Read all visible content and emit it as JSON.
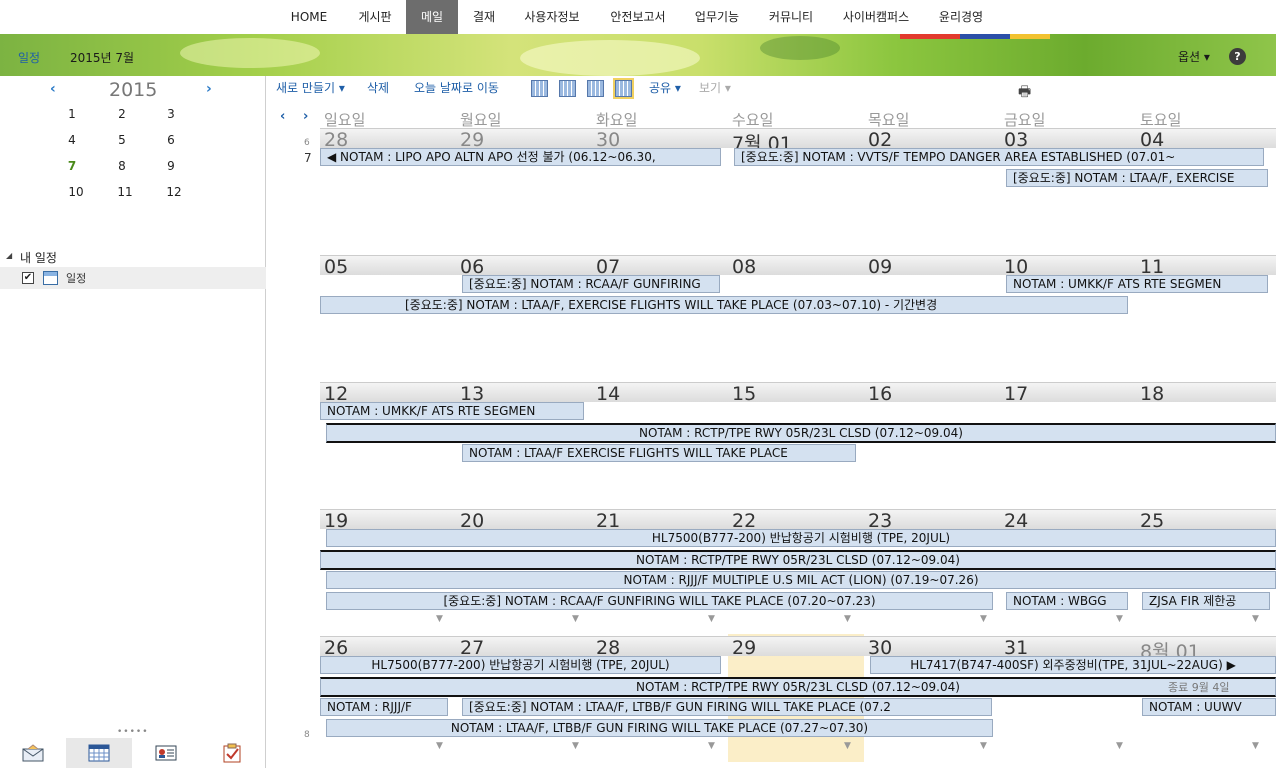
{
  "topnav": {
    "items": [
      "HOME",
      "게시판",
      "메일",
      "결재",
      "사용자정보",
      "안전보고서",
      "업무기능",
      "커뮤니티",
      "사이버캠퍼스",
      "윤리경영"
    ],
    "active": "메일"
  },
  "banner": {
    "section": "일정",
    "period": "2015년 7월",
    "options": "옵션 ▾",
    "help": "?"
  },
  "minical": {
    "year": "2015",
    "prev": "‹",
    "next": "›",
    "months": [
      "1",
      "2",
      "3",
      "4",
      "5",
      "6",
      "7",
      "8",
      "9",
      "10",
      "11",
      "12"
    ],
    "current_month": "7"
  },
  "tree": {
    "toggle": "◢",
    "root": "내 일정",
    "calendar_name": "일정",
    "checked": "✔"
  },
  "leftpane": {
    "dots": "•••••"
  },
  "bottom_tabs": [
    "mail-icon",
    "calendar-icon",
    "contacts-icon",
    "tasks-icon"
  ],
  "toolbar": {
    "new": "새로 만들기 ▾",
    "delete": "삭제",
    "today": "오늘 날짜로 이동",
    "share": "공유 ▾",
    "view": "보기 ▾",
    "print": "🖶"
  },
  "calendar": {
    "nav_prev": "‹",
    "nav_next": "›",
    "weekdays": [
      "일요일",
      "월요일",
      "화요일",
      "수요일",
      "목요일",
      "금요일",
      "토요일"
    ],
    "week_labels": {
      "w1_num": "6",
      "w1_mon": "7",
      "last_num": "8"
    },
    "weeks": [
      {
        "days": [
          "28",
          "29",
          "30",
          "7월 01",
          "02",
          "03",
          "04"
        ]
      },
      {
        "days": [
          "05",
          "06",
          "07",
          "08",
          "09",
          "10",
          "11"
        ]
      },
      {
        "days": [
          "12",
          "13",
          "14",
          "15",
          "16",
          "17",
          "18"
        ]
      },
      {
        "days": [
          "19",
          "20",
          "21",
          "22",
          "23",
          "24",
          "25"
        ]
      },
      {
        "days": [
          "26",
          "27",
          "28",
          "29",
          "30",
          "31",
          "8월 01"
        ]
      }
    ],
    "today_label": "29",
    "end_label": "종료 9월 4일",
    "events": {
      "w1e1": "◀ NOTAM : LIPO APO ALTN APO 선정 불가 (06.12~06.30,",
      "w1e2": "[중요도:중] NOTAM : VVTS/F TEMPO DANGER AREA ESTABLISHED (07.01~",
      "w1e3": "[중요도:중] NOTAM : LTAA/F, EXERCISE",
      "w2e1": "[중요도:중] NOTAM : RCAA/F GUNFIRING",
      "w2e2": "NOTAM : UMKK/F ATS RTE SEGMEN",
      "w2e3": "[중요도:중] NOTAM : LTAA/F, EXERCISE FLIGHTS WILL TAKE PLACE (07.03~07.10) - 기간변경",
      "w3e1": "NOTAM : UMKK/F ATS RTE SEGMEN",
      "w3e2": "NOTAM : RCTP/TPE RWY 05R/23L CLSD (07.12~09.04)",
      "w3e3": "NOTAM : LTAA/F EXERCISE FLIGHTS WILL TAKE PLACE",
      "w4e1": "HL7500(B777-200) 반납항공기 시험비행 (TPE, 20JUL)",
      "w4e2": "NOTAM : RCTP/TPE RWY 05R/23L CLSD (07.12~09.04)",
      "w4e3": "NOTAM : RJJJ/F MULTIPLE U.S MIL ACT (LION) (07.19~07.26)",
      "w4e4": "[중요도:중] NOTAM : RCAA/F GUNFIRING WILL TAKE PLACE (07.20~07.23)",
      "w4e5": "NOTAM : WBGG",
      "w4e6": "ZJSA FIR 제한공",
      "w5e1": "HL7500(B777-200) 반납항공기 시험비행 (TPE, 20JUL)",
      "w5e2": "HL7417(B747-400SF) 외주중정비(TPE, 31JUL~22AUG) ▶",
      "w5e3": "NOTAM : RCTP/TPE RWY 05R/23L CLSD (07.12~09.04)",
      "w5e4": "NOTAM : RJJJ/F",
      "w5e5": "[중요도:중] NOTAM : LTAA/F, LTBB/F GUN FIRING WILL TAKE PLACE (07.2",
      "w5e6": "NOTAM : UUWV",
      "w5e7": "NOTAM : LTAA/F, LTBB/F GUN FIRING WILL TAKE PLACE (07.27~07.30)"
    },
    "more_marker": "▼"
  },
  "colors": {
    "accent": "#1f5fa8",
    "event_bg": "#d4e1f0",
    "today_bg": "#fbeec8",
    "nav_active": "#6d6d6d"
  }
}
